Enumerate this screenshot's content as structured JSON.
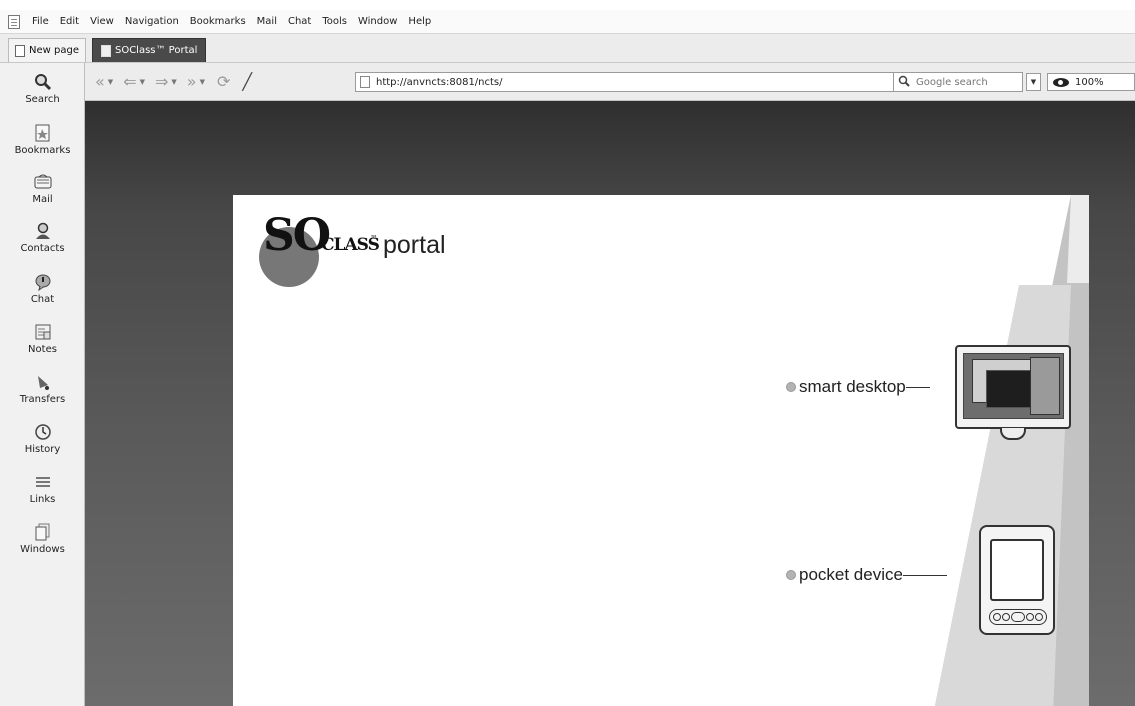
{
  "menu": {
    "items": [
      "File",
      "Edit",
      "View",
      "Navigation",
      "Bookmarks",
      "Mail",
      "Chat",
      "Tools",
      "Window",
      "Help"
    ]
  },
  "tabs": {
    "new_page": "New page",
    "active": "SOClass™ Portal"
  },
  "panel": {
    "items": [
      {
        "label": "Search",
        "icon": "search-icon"
      },
      {
        "label": "Bookmarks",
        "icon": "bookmarks-icon"
      },
      {
        "label": "Mail",
        "icon": "mail-icon"
      },
      {
        "label": "Contacts",
        "icon": "contacts-icon"
      },
      {
        "label": "Chat",
        "icon": "chat-icon"
      },
      {
        "label": "Notes",
        "icon": "notes-icon"
      },
      {
        "label": "Transfers",
        "icon": "transfers-icon"
      },
      {
        "label": "History",
        "icon": "history-icon"
      },
      {
        "label": "Links",
        "icon": "links-icon"
      },
      {
        "label": "Windows",
        "icon": "windows-icon"
      }
    ]
  },
  "toolbar": {
    "url": "http://anvncts:8081/ncts/",
    "search_placeholder": "Google search",
    "zoom": "100%"
  },
  "portal": {
    "logo_so": "SO",
    "logo_class": "CLASS",
    "logo_tm": "™",
    "logo_portal": "portal",
    "option_desktop": "smart desktop",
    "option_pocket": "pocket device"
  }
}
